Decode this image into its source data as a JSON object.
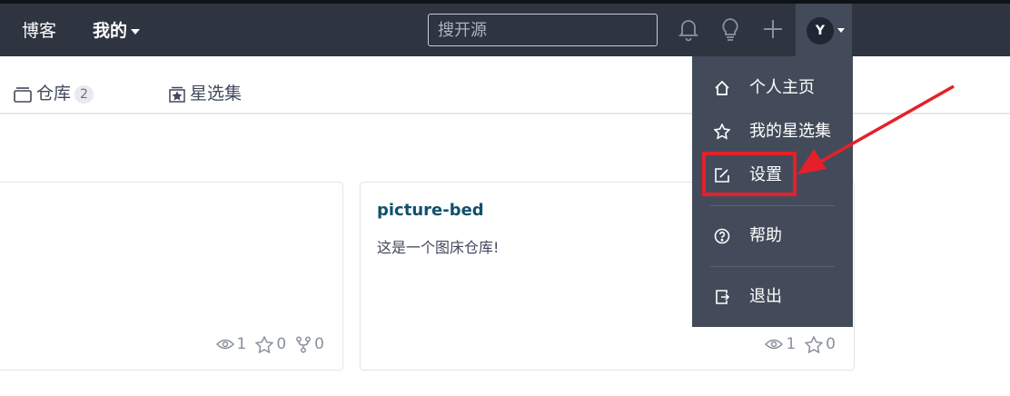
{
  "nav": {
    "blog": "博客",
    "mine": "我的"
  },
  "search": {
    "placeholder": "搜开源"
  },
  "user": {
    "avatar_initial": "Y"
  },
  "tabs": [
    {
      "label": "仓库",
      "count": "2"
    },
    {
      "label": "星选集"
    }
  ],
  "cards": [
    {
      "title": "",
      "description": "",
      "stats": {
        "watch": "1",
        "star": "0",
        "fork": "0"
      }
    },
    {
      "title": "picture-bed",
      "description": "这是一个图床仓库!",
      "stats": {
        "watch": "1",
        "star": "0"
      }
    }
  ],
  "dropdown": {
    "items": [
      {
        "label": "个人主页",
        "icon": "home-icon"
      },
      {
        "label": "我的星选集",
        "icon": "star-icon"
      },
      {
        "label": "设置",
        "icon": "edit-icon"
      },
      {
        "label": "帮助",
        "icon": "help-icon"
      },
      {
        "label": "退出",
        "icon": "logout-icon"
      }
    ]
  },
  "colors": {
    "topbar": "#2e3440",
    "dropdown": "#434b5a",
    "highlight": "#e5202a",
    "card_title": "#11506b"
  }
}
